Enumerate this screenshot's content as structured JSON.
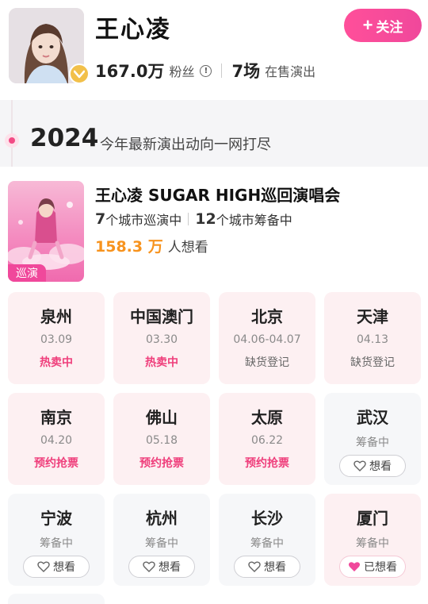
{
  "artist": {
    "name": "王心凌",
    "follow_label": "关注",
    "followers_value": "167.0万",
    "followers_label": "粉丝",
    "shows_value": "7场",
    "shows_label": "在售演出"
  },
  "year_banner": {
    "year": "2024",
    "subtitle": "今年最新演出动向一网打尽"
  },
  "tour": {
    "title": "王心凌 SUGAR HIGH巡回演唱会",
    "poster_tag": "巡演",
    "touring_count": "7",
    "touring_label": "个城市巡演中",
    "preparing_count": "12",
    "preparing_label": "个城市筹备中",
    "want_value": "158.3 万",
    "want_label": "人想看"
  },
  "cities": [
    {
      "name": "泉州",
      "date": "03.09",
      "status": "热卖中",
      "kind": "hot"
    },
    {
      "name": "中国澳门",
      "date": "03.30",
      "status": "热卖中",
      "kind": "hot"
    },
    {
      "name": "北京",
      "date": "04.06-04.07",
      "status": "缺货登记",
      "kind": "soldout"
    },
    {
      "name": "天津",
      "date": "04.13",
      "status": "缺货登记",
      "kind": "soldout"
    },
    {
      "name": "南京",
      "date": "04.20",
      "status": "预约抢票",
      "kind": "presale"
    },
    {
      "name": "佛山",
      "date": "05.18",
      "status": "预约抢票",
      "kind": "presale"
    },
    {
      "name": "太原",
      "date": "06.22",
      "status": "预约抢票",
      "kind": "presale"
    },
    {
      "name": "武汉",
      "date": "筹备中",
      "status": "想看",
      "kind": "want"
    },
    {
      "name": "宁波",
      "date": "筹备中",
      "status": "想看",
      "kind": "want"
    },
    {
      "name": "杭州",
      "date": "筹备中",
      "status": "想看",
      "kind": "want"
    },
    {
      "name": "长沙",
      "date": "筹备中",
      "status": "想看",
      "kind": "want"
    },
    {
      "name": "厦门",
      "date": "筹备中",
      "status": "已想看",
      "kind": "wanted"
    }
  ],
  "colors": {
    "accent_pink": "#f0489b",
    "hot_text": "#ef3e7b",
    "want_orange": "#f7931e",
    "verified_gold": "#f2c04a"
  },
  "icons": {
    "verified": "verified-badge-icon",
    "info": "info-circle-icon",
    "heart": "heart-icon"
  }
}
